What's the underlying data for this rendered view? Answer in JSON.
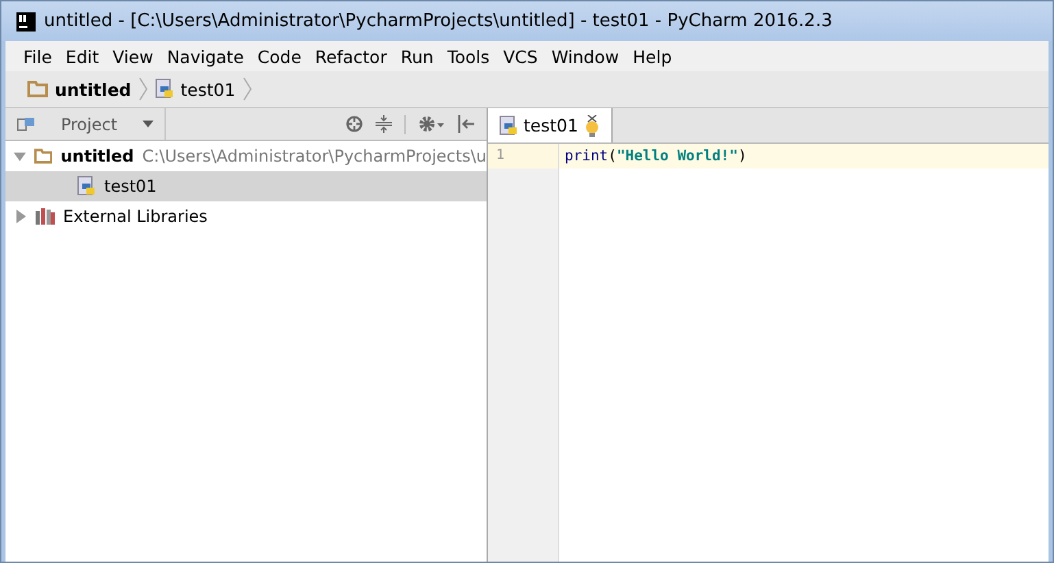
{
  "window": {
    "title": "untitled - [C:\\Users\\Administrator\\PycharmProjects\\untitled] - test01 - PyCharm 2016.2.3"
  },
  "menu": [
    "File",
    "Edit",
    "View",
    "Navigate",
    "Code",
    "Refactor",
    "Run",
    "Tools",
    "VCS",
    "Window",
    "Help"
  ],
  "breadcrumb": [
    {
      "label": "untitled",
      "kind": "folder"
    },
    {
      "label": "test01",
      "kind": "python"
    }
  ],
  "project_panel": {
    "title": "Project",
    "tree": [
      {
        "label": "untitled",
        "path": "C:\\Users\\Administrator\\PycharmProjects\\u",
        "kind": "folder",
        "expanded": true,
        "selected": false,
        "children": [
          {
            "label": "test01",
            "kind": "python",
            "selected": true
          }
        ]
      },
      {
        "label": "External Libraries",
        "kind": "library",
        "expanded": false,
        "selected": false
      }
    ]
  },
  "editor": {
    "tabs": [
      {
        "label": "test01",
        "selected": true
      }
    ],
    "lines": [
      {
        "number": "1",
        "tokens": [
          {
            "text": "print",
            "kind": "keyword"
          },
          {
            "text": "(",
            "kind": "plain"
          },
          {
            "text": "\"Hello World!\"",
            "kind": "string"
          },
          {
            "text": ")",
            "kind": "plain"
          }
        ]
      }
    ]
  }
}
